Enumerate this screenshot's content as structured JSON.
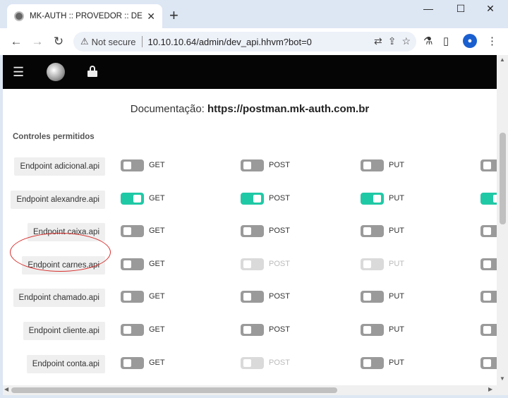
{
  "browser": {
    "tab_title": "MK-AUTH :: PROVEDOR :: DEV :: A",
    "new_tab": "+",
    "not_secure": "Not secure",
    "url": "10.10.10.64/admin/dev_api.hhvm?bot=0",
    "controls": {
      "minimize": "—",
      "maximize": "☐",
      "close": "✕"
    }
  },
  "page": {
    "doc_prefix": "Documentação:",
    "doc_url": "https://postman.mk-auth.com.br",
    "section_title": "Controles permitidos",
    "methods": [
      "GET",
      "POST",
      "PUT"
    ],
    "endpoints": [
      {
        "label": "Endpoint adicional.api",
        "states": [
          "off",
          "off",
          "off",
          "off"
        ]
      },
      {
        "label": "Endpoint alexandre.api",
        "states": [
          "on",
          "on",
          "on",
          "on"
        ]
      },
      {
        "label": "Endpoint caixa.api",
        "states": [
          "off",
          "off",
          "off",
          "off"
        ]
      },
      {
        "label": "Endpoint carnes.api",
        "states": [
          "off",
          "disabled",
          "disabled",
          "off"
        ]
      },
      {
        "label": "Endpoint chamado.api",
        "states": [
          "off",
          "off",
          "off",
          "off"
        ]
      },
      {
        "label": "Endpoint cliente.api",
        "states": [
          "off",
          "off",
          "off",
          "off"
        ]
      },
      {
        "label": "Endpoint conta.api",
        "states": [
          "off",
          "disabled",
          "off",
          "off"
        ]
      }
    ]
  },
  "colors": {
    "toggle_on": "#20c9a6",
    "toggle_off": "#9a9a9a",
    "highlight": "#d6302e"
  }
}
